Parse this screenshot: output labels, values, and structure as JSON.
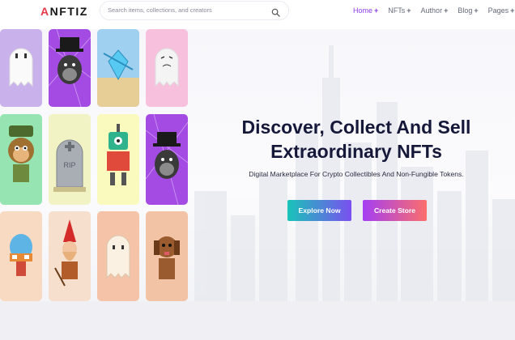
{
  "header": {
    "logo_left": "A",
    "logo_mid": "NFT",
    "logo_right": "IZ",
    "search_placeholder": "Search items, collections, and creators",
    "search_icon": "search-icon",
    "nav": [
      {
        "label": "Home",
        "active": true
      },
      {
        "label": "NFTs"
      },
      {
        "label": "Author"
      },
      {
        "label": "Blog"
      },
      {
        "label": "Pages"
      }
    ],
    "nav_plus": "+"
  },
  "hero": {
    "title_line1": "Discover, Collect And Sell",
    "title_line2": "Extraordinary NFTs",
    "subtitle": "Digital Marketplace For Crypto Collectibles And Non-Fungible Tokens.",
    "explore_label": "Explore Now",
    "store_label": "Create Store"
  },
  "gallery": [
    {
      "name": "ghost-white",
      "bg": "#c9b1ec"
    },
    {
      "name": "ape-purple",
      "bg": "#a44be3"
    },
    {
      "name": "crystal-blue",
      "bg": "#9fd0ef"
    },
    {
      "name": "ghost-pink",
      "bg": "#f7c1de"
    },
    {
      "name": "monkey-green",
      "bg": "#95e4b1"
    },
    {
      "name": "tombstone-rip",
      "bg": "#f2f3c5"
    },
    {
      "name": "robot-green",
      "bg": "#fafabe"
    },
    {
      "name": "ape-purple-2",
      "bg": "#a44be3"
    },
    {
      "name": "robot-egg",
      "bg": "#f8d9c1"
    },
    {
      "name": "gnome-red",
      "bg": "#f7dfcd"
    },
    {
      "name": "ghost-cream",
      "bg": "#f5c3a8"
    },
    {
      "name": "dog-brown",
      "bg": "#f2c3a4"
    }
  ],
  "colors": {
    "accent": "#8b3cf0",
    "title": "#16183a"
  }
}
